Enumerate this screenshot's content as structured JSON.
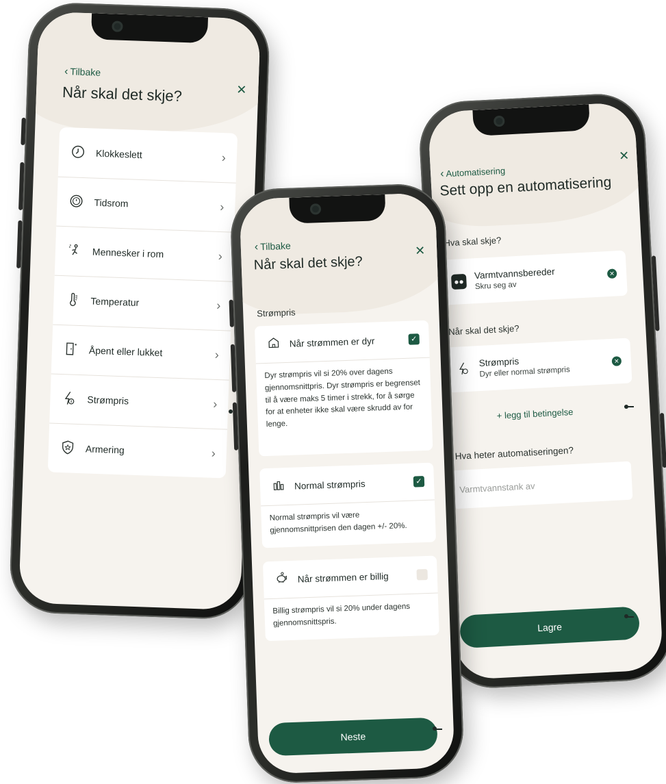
{
  "screen1": {
    "back_label": "Tilbake",
    "title": "Når skal det skje?",
    "close_glyph": "✕",
    "items": [
      {
        "label": "Klokkeslett",
        "icon": "clock-icon"
      },
      {
        "label": "Tidsrom",
        "icon": "timer-icon"
      },
      {
        "label": "Mennesker i rom",
        "icon": "motion-icon"
      },
      {
        "label": "Temperatur",
        "icon": "thermometer-icon"
      },
      {
        "label": "Åpent eller lukket",
        "icon": "door-icon"
      },
      {
        "label": "Strømpris",
        "icon": "power-price-icon"
      },
      {
        "label": "Armering",
        "icon": "shield-icon"
      }
    ]
  },
  "screen2": {
    "back_label": "Tilbake",
    "title": "Når skal det skje?",
    "close_glyph": "✕",
    "section_label": "Strømpris",
    "options": [
      {
        "label": "Når strømmen er dyr",
        "checked": true,
        "icon": "expensive-icon",
        "body": "Dyr strømpris vil si 20% over dagens gjennomsnittpris. Dyr strømpris er begrenset til å være maks 5 timer i strekk, for å sørge for at enheter ikke skal være skrudd av for lenge."
      },
      {
        "label": "Normal strømpris",
        "checked": true,
        "icon": "normal-price-icon",
        "body": "Normal strømpris vil være gjennomsnittprisen den dagen +/- 20%."
      },
      {
        "label": "Når strømmen er billig",
        "checked": false,
        "icon": "piggy-bank-icon",
        "body": "Billig strømpris vil si 20% under dagens gjennomsnittspris."
      }
    ],
    "next_label": "Neste"
  },
  "screen3": {
    "back_label": "Automatisering",
    "title": "Sett opp en automatisering",
    "close_glyph": "✕",
    "what_label": "Hva skal skje?",
    "action": {
      "title": "Varmtvannsbereder",
      "subtitle": "Skru seg av",
      "icon": "outlet-icon"
    },
    "when_label": "Når skal det skje?",
    "condition": {
      "title": "Strømpris",
      "subtitle": "Dyr eller normal strømpris",
      "icon": "power-price-icon"
    },
    "add_condition": "+ legg til betingelse",
    "name_label": "Hva heter automatiseringen?",
    "name_value": "Varmtvannstank av",
    "save_label": "Lagre"
  },
  "colors": {
    "accent": "#1d5a43",
    "background": "#f6f3ee",
    "card": "#ffffff"
  }
}
